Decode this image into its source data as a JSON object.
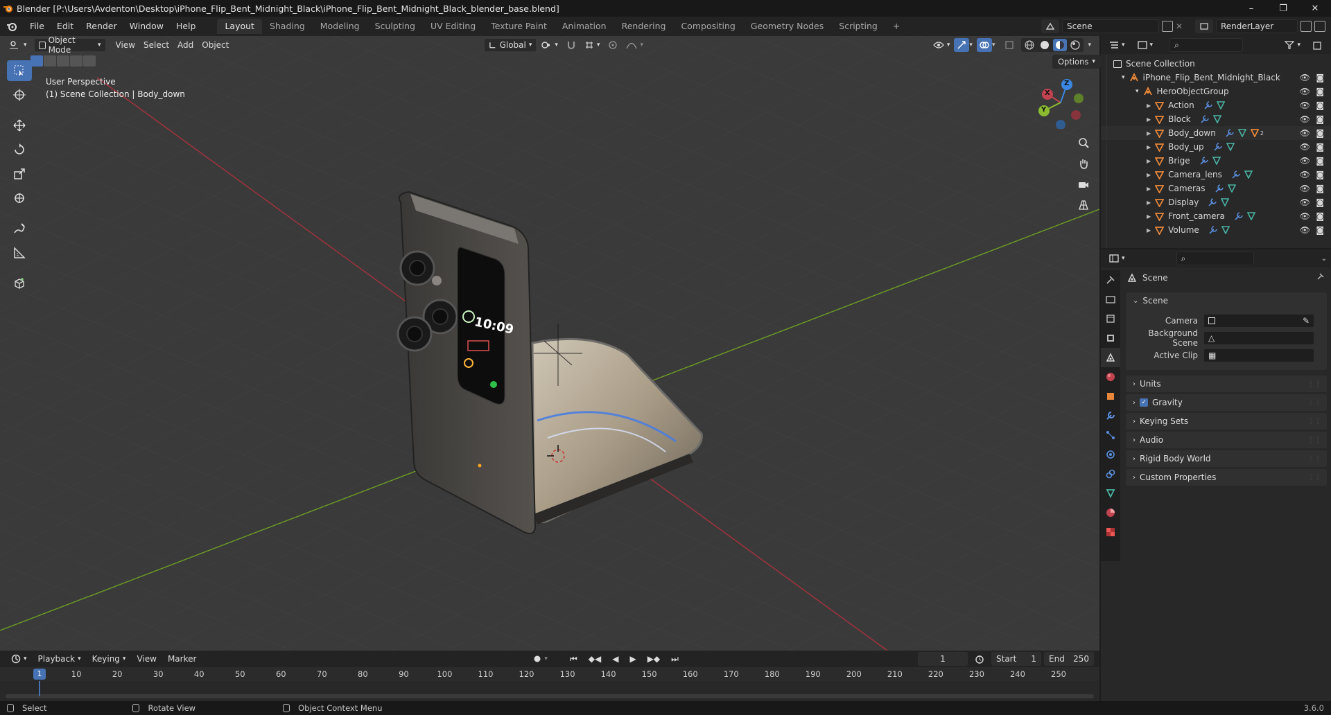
{
  "window": {
    "title": "Blender [P:\\Users\\Avdenton\\Desktop\\iPhone_Flip_Bent_Midnight_Black\\iPhone_Flip_Bent_Midnight_Black_blender_base.blend]",
    "minimize": "–",
    "maximize": "❐",
    "close": "✕"
  },
  "menu": [
    "File",
    "Edit",
    "Render",
    "Window",
    "Help"
  ],
  "workspaces": [
    "Layout",
    "Shading",
    "Modeling",
    "Sculpting",
    "UV Editing",
    "Texture Paint",
    "Animation",
    "Rendering",
    "Compositing",
    "Geometry Nodes",
    "Scripting"
  ],
  "add_workspace": "+",
  "scene_field": "Scene",
  "render_layer_field": "RenderLayer",
  "viewport": {
    "mode": "Object Mode",
    "menus": [
      "View",
      "Select",
      "Add",
      "Object"
    ],
    "transform_orientation": "Global",
    "options": "Options",
    "perspective": "User Perspective",
    "collection_info": "(1) Scene Collection | Body_down",
    "phone_time": "10:09"
  },
  "gizmo": {
    "x": "X",
    "y": "Y",
    "z": "Z"
  },
  "outliner": {
    "root": "Scene Collection",
    "file": "iPhone_Flip_Bent_Midnight_Black",
    "group": "HeroObjectGroup",
    "items": [
      "Action",
      "Block",
      "Body_down",
      "Body_up",
      "Brige",
      "Camera_lens",
      "Cameras",
      "Display",
      "Front_camera",
      "Volume"
    ],
    "material_count": "2"
  },
  "properties": {
    "header": "Scene",
    "section": "Scene",
    "fields": [
      "Camera",
      "Background Scene",
      "Active Clip"
    ],
    "panels": [
      "Units",
      "Gravity",
      "Keying Sets",
      "Audio",
      "Rigid Body World",
      "Custom Properties"
    ],
    "gravity_checked": true
  },
  "timeline": {
    "menus": [
      "Playback",
      "Keying",
      "View",
      "Marker"
    ],
    "current_frame": "1",
    "start_label": "Start",
    "start": "1",
    "end_label": "End",
    "end": "250",
    "ruler": [
      "10",
      "20",
      "30",
      "40",
      "50",
      "60",
      "70",
      "80",
      "90",
      "100",
      "110",
      "120",
      "130",
      "140",
      "150",
      "160",
      "170",
      "180",
      "190",
      "200",
      "210",
      "220",
      "230",
      "240",
      "250"
    ],
    "playhead": "1"
  },
  "status": {
    "select": "Select",
    "rotate": "Rotate View",
    "context": "Object Context Menu",
    "version": "3.6.0"
  },
  "colors": {
    "accent": "#4772b3",
    "x_axis": "#a8323d",
    "y_axis": "#6f9e23",
    "object_orange": "#e8873a",
    "mesh_green": "#49b4a3"
  }
}
